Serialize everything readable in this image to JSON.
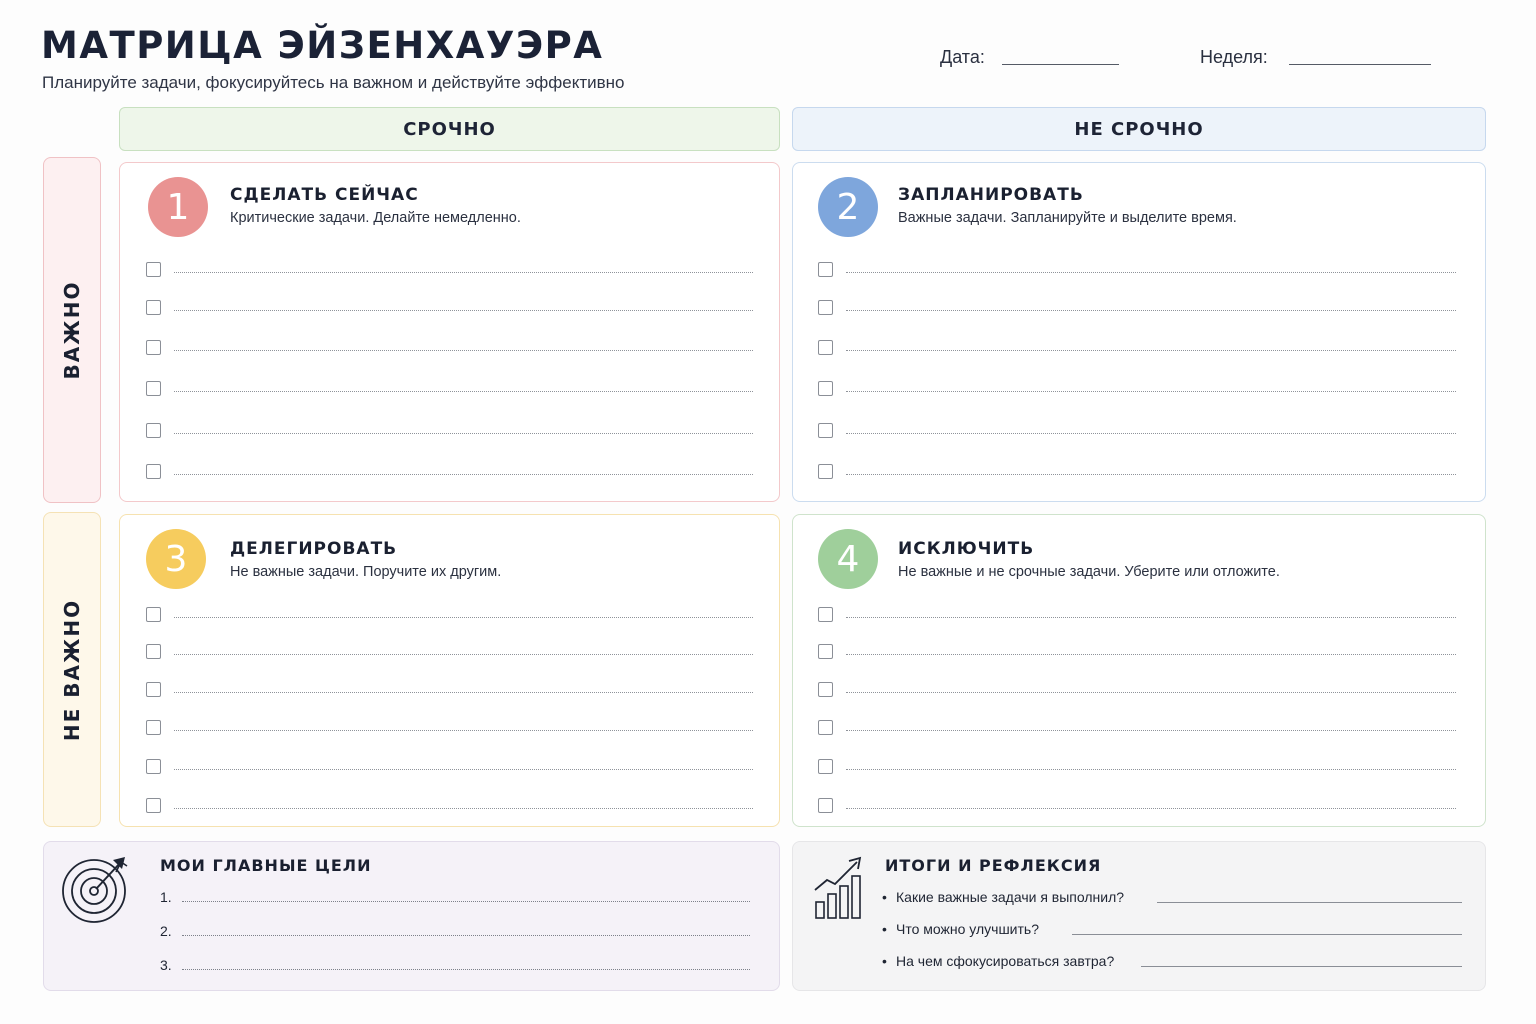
{
  "header": {
    "title": "МАТРИЦА ЭЙЗЕНХАУЭРА",
    "subtitle": "Планируйте задачи, фокусируйтесь на важном и действуйте эффективно",
    "date_label": "Дата:",
    "week_label": "Неделя:"
  },
  "columns": {
    "urgent": "СРОЧНО",
    "not_urgent": "НЕ СРОЧНО"
  },
  "rows": {
    "important": "ВАЖНО",
    "not_important": "НЕ ВАЖНО"
  },
  "quadrants": [
    {
      "number": "1",
      "title": "СДЕЛАТЬ СЕЙЧАС",
      "description": "Критические задачи. Делайте немедленно.",
      "color": "#e99392",
      "task_count": 6
    },
    {
      "number": "2",
      "title": "ЗАПЛАНИРОВАТЬ",
      "description": "Важные задачи. Запланируйте и выделите время.",
      "color": "#7ea6dc",
      "task_count": 6
    },
    {
      "number": "3",
      "title": "ДЕЛЕГИРОВАТЬ",
      "description": "Не важные задачи. Поручите их другим.",
      "color": "#f6cc5e",
      "task_count": 6
    },
    {
      "number": "4",
      "title": "ИСКЛЮЧИТЬ",
      "description": "Не важные и не срочные задачи. Уберите или отложите.",
      "color": "#9fcf9b",
      "task_count": 6
    }
  ],
  "goals": {
    "title": "МОИ ГЛАВНЫЕ ЦЕЛИ",
    "icon": "target-icon",
    "items": [
      "1.",
      "2.",
      "3."
    ]
  },
  "reflection": {
    "title": "ИТОГИ И РЕФЛЕКСИЯ",
    "icon": "growth-chart-icon",
    "bullet": "•",
    "questions": [
      "Какие важные задачи я выполнил?",
      "Что можно улучшить?",
      "На чем сфокусироваться завтра?"
    ]
  },
  "colors": {
    "urgent_header_bg": "#eef6ea",
    "not_urgent_header_bg": "#edf3fa",
    "important_row_bg": "#fdf0f1",
    "not_important_row_bg": "#fef8ea",
    "goals_panel_bg": "#f5f2f8",
    "reflection_panel_bg": "#f4f4f5"
  }
}
